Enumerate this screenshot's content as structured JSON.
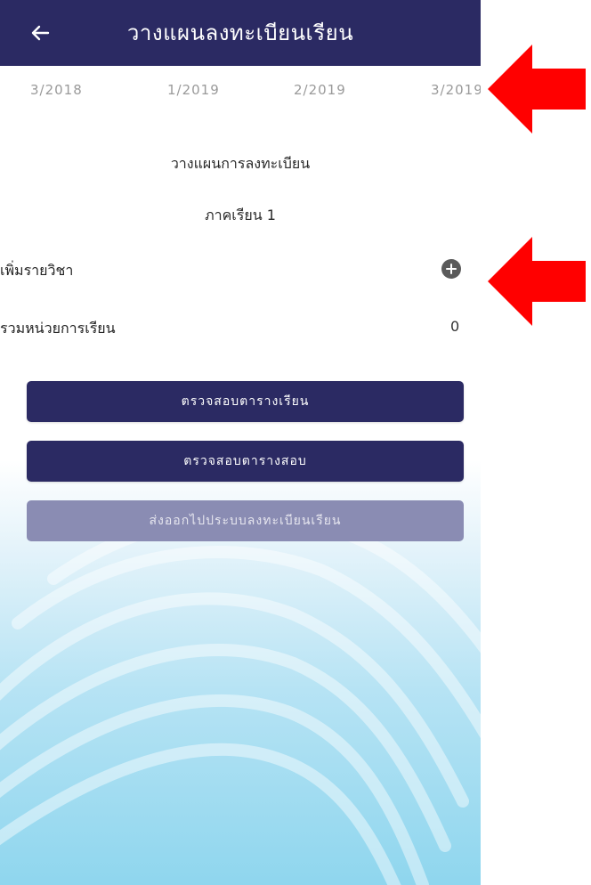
{
  "app_bar": {
    "title": "วางแผนลงทะเบียนเรียน",
    "back_icon": "arrow-left-icon"
  },
  "semester_tabs": [
    "3/2018",
    "1/2019",
    "2/2019",
    "3/2019"
  ],
  "plan": {
    "heading": "วางแผนการลงทะเบียน",
    "term_label": "ภาคเรียน 1",
    "add_course_label": "เพิ่มรายวิชา",
    "add_course_icon": "plus-circle-icon",
    "total_credits_label": "รวมหน่วยการเรียน",
    "total_credits_value": "0"
  },
  "buttons": {
    "check_timetable": "ตรวจสอบตารางเรียน",
    "check_exam_schedule": "ตรวจสอบตารางสอบ",
    "export_to_registration": "ส่งออกไปประบบลงทะเบียนเรียน"
  },
  "annotations": {
    "arrow_color": "#ff0000",
    "arrow_icon": "left-arrow-icon"
  },
  "colors": {
    "primary": "#2b2a63",
    "disabled": "#8a8cb3"
  }
}
